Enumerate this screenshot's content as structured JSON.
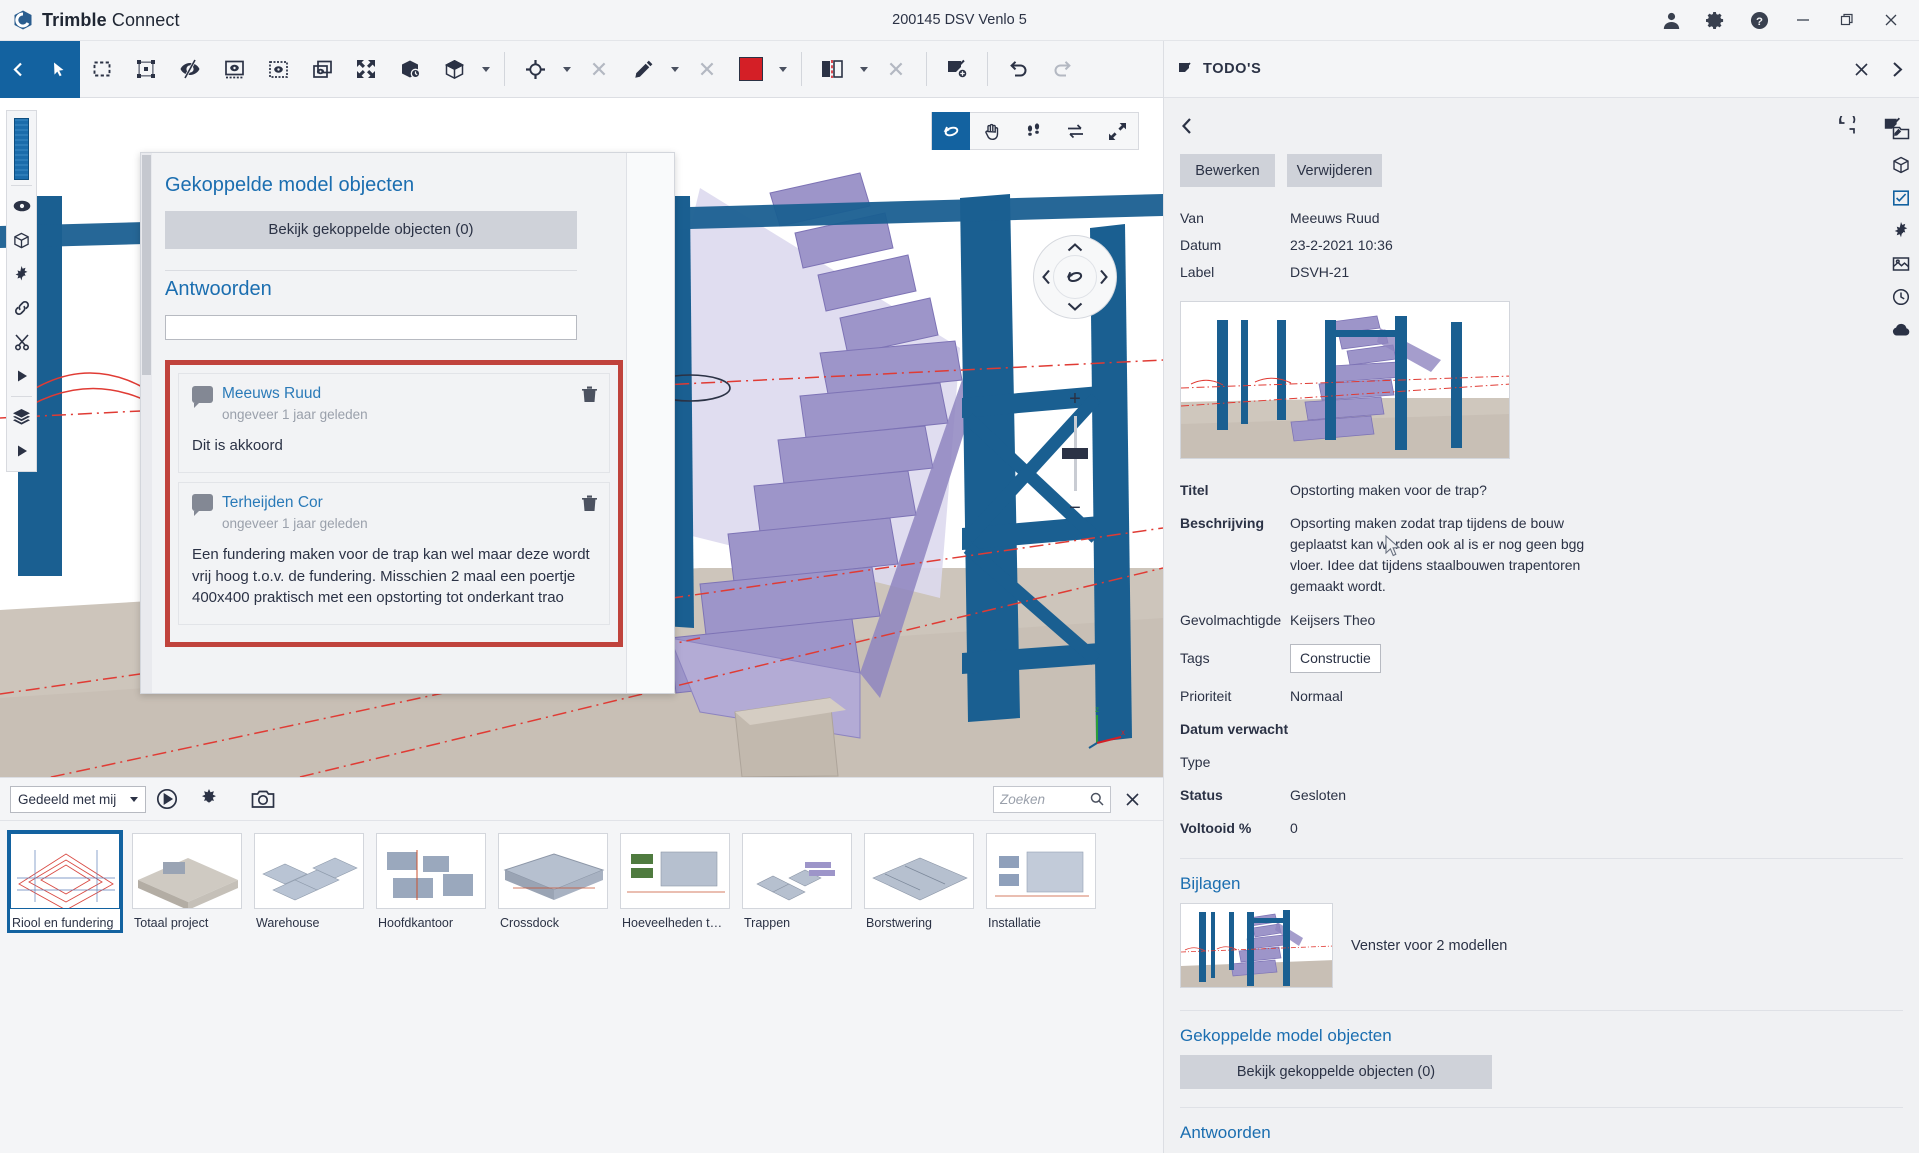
{
  "titlebar": {
    "brand_bold": "Trimble",
    "brand_light": "Connect",
    "project_title": "200145 DSV Venlo 5",
    "icons": {
      "account": "account-icon",
      "settings": "gear-icon",
      "help": "help-icon",
      "minimize": "minimize-icon",
      "restore": "restore-icon",
      "close": "close-icon"
    }
  },
  "toolbar": {
    "items": [
      {
        "name": "back-button",
        "icon": "chevron-left-icon"
      },
      {
        "name": "select-tool",
        "icon": "cursor-arrow-icon"
      },
      {
        "name": "rectangle-select-tool",
        "icon": "marquee-select-icon"
      },
      {
        "name": "transform-tool",
        "icon": "bounding-box-icon"
      },
      {
        "name": "hide-tool",
        "icon": "eye-slash-icon"
      },
      {
        "name": "isolate-tool",
        "icon": "eye-in-frame-icon"
      },
      {
        "name": "show-selection-tool",
        "icon": "eye-dotted-frame-icon"
      },
      {
        "name": "show-all-tool",
        "icon": "eye-layers-icon"
      },
      {
        "name": "fit-view-tool",
        "icon": "expand-arrows-icon"
      },
      {
        "name": "section-box-tool",
        "icon": "cube-clock-icon"
      },
      {
        "name": "cube-tool",
        "icon": "cube-icon"
      },
      {
        "name": "marker-tool",
        "icon": "target-icon"
      },
      {
        "name": "clear-marker-tool",
        "icon": "x-icon"
      },
      {
        "name": "pen-tool",
        "icon": "pencil-icon"
      },
      {
        "name": "clear-pen-tool",
        "icon": "x-icon"
      },
      {
        "name": "color-swatch",
        "icon": "color-swatch-icon"
      },
      {
        "name": "split-view-tool",
        "icon": "split-panel-icon"
      },
      {
        "name": "clear-view-tool",
        "icon": "x-icon"
      },
      {
        "name": "add-todo-tool",
        "icon": "checklist-plus-icon"
      },
      {
        "name": "undo-button",
        "icon": "undo-icon"
      },
      {
        "name": "redo-button",
        "icon": "redo-icon"
      }
    ],
    "swatch_color": "#d41f26"
  },
  "viewport": {
    "nav_tools": [
      {
        "name": "orbit-tool",
        "icon": "orbit-icon"
      },
      {
        "name": "pan-tool",
        "icon": "hand-icon"
      },
      {
        "name": "walk-tool",
        "icon": "footsteps-icon"
      },
      {
        "name": "flip-tool",
        "icon": "swap-arrows-icon"
      },
      {
        "name": "zoom-extents-tool",
        "icon": "diagonal-arrows-icon"
      }
    ],
    "left_tools": [
      {
        "name": "measure-slider",
        "icon": "gradient-slider-icon"
      },
      {
        "name": "visibility-tool",
        "icon": "eye-icon"
      },
      {
        "name": "model-tool",
        "icon": "cube-outline-icon"
      },
      {
        "name": "settings-tool",
        "icon": "gear-small-icon"
      },
      {
        "name": "link-tool",
        "icon": "link-icon"
      },
      {
        "name": "clip-tool",
        "icon": "scissors-icon"
      },
      {
        "name": "play-tool",
        "icon": "play-icon"
      },
      {
        "name": "layers-tool",
        "icon": "layers-icon"
      },
      {
        "name": "more-tool",
        "icon": "play-icon"
      }
    ],
    "wheel": {
      "up": "chevron-up-icon",
      "down": "chevron-down-icon",
      "left": "chevron-left-icon",
      "right": "chevron-right-icon",
      "center": "orbit-icon"
    },
    "zoom": {
      "plus": "+",
      "minus": "−"
    }
  },
  "modal": {
    "linked_objects_heading": "Gekoppelde model objecten",
    "view_linked_button": "Bekijk gekoppelde objecten (0)",
    "answers_heading": "Antwoorden",
    "answer_placeholder": "",
    "answer_value": "",
    "comments": [
      {
        "author": "Meeuws Ruud",
        "time": "ongeveer 1 jaar geleden",
        "text": "Dit is akkoord",
        "delete_icon": "trash-icon"
      },
      {
        "author": "Terheijden Cor",
        "time": "ongeveer 1 jaar geleden",
        "text": "Een fundering maken voor de trap kan wel maar deze wordt vrij hoog t.o.v. de fundering. Misschien 2 maal een poertje 400x400 praktisch met een opstorting tot onderkant trao",
        "delete_icon": "trash-icon"
      }
    ]
  },
  "bottombar": {
    "filter_value": "Gedeeld met mij",
    "play_icon": "play-icon",
    "settings_icon": "gear-icon",
    "camera_icon": "camera-icon",
    "search_placeholder": "Zoeken",
    "search_value": "",
    "search_icon": "search-icon",
    "close_icon": "close-icon"
  },
  "thumbnails": [
    {
      "label": "Riool en fundering",
      "selected": true
    },
    {
      "label": "Totaal project",
      "selected": false
    },
    {
      "label": "Warehouse",
      "selected": false
    },
    {
      "label": "Hoofdkantoor",
      "selected": false
    },
    {
      "label": "Crossdock",
      "selected": false
    },
    {
      "label": "Hoeveelheden teke",
      "selected": false
    },
    {
      "label": "Trappen",
      "selected": false
    },
    {
      "label": "Borstwering",
      "selected": false
    },
    {
      "label": "Installatie",
      "selected": false
    }
  ],
  "rightpanel": {
    "header_title": "TODO'S",
    "header_icon": "checklist-icon",
    "close_icon": "close-icon",
    "expand_icon": "chevron-right-icon",
    "back_icon": "chevron-left-icon",
    "refresh_icon": "refresh-icon",
    "edit_todo_icon": "checklist-edit-icon",
    "buttons": {
      "edit": "Bewerken",
      "delete": "Verwijderen"
    },
    "meta_top": [
      {
        "key": "Van",
        "value": "Meeuws Ruud"
      },
      {
        "key": "Datum",
        "value": "23-2-2021 10:36"
      },
      {
        "key": "Label",
        "value": "DSVH-21"
      }
    ],
    "details": [
      {
        "key": "Titel",
        "value": "Opstorting maken voor de trap?",
        "bold": true
      },
      {
        "key": "Beschrijving",
        "value": "Opsorting maken zodat trap tijdens de bouw geplaatst kan worden ook al is er nog geen bgg vloer. Idee dat tijdens staalbouwen trapentoren gemaakt wordt.",
        "bold": true
      },
      {
        "key": "Gevolmachtigde",
        "value": "Keijsers Theo",
        "bold": false
      },
      {
        "key": "Tags",
        "value": "Constructie",
        "bold": false,
        "is_tag": true
      },
      {
        "key": "Prioriteit",
        "value": "Normaal",
        "bold": false
      },
      {
        "key": "Datum verwacht",
        "value": "",
        "bold": true
      },
      {
        "key": "Type",
        "value": "",
        "bold": false
      },
      {
        "key": "Status",
        "value": "Gesloten",
        "bold": true
      },
      {
        "key": "Voltooid %",
        "value": "0",
        "bold": true
      }
    ],
    "attachments_heading": "Bijlagen",
    "attachment_label": "Venster voor 2 modellen",
    "linked_objects_heading": "Gekoppelde model objecten",
    "view_linked_button": "Bekijk gekoppelde objecten (0)",
    "answers_heading": "Antwoorden",
    "rail_icons": [
      {
        "name": "rail-project-icon",
        "active": false
      },
      {
        "name": "rail-model-icon",
        "active": false
      },
      {
        "name": "rail-todo-icon",
        "active": true
      },
      {
        "name": "rail-settings-icon",
        "active": false
      },
      {
        "name": "rail-views-icon",
        "active": false
      },
      {
        "name": "rail-history-icon",
        "active": false
      },
      {
        "name": "rail-cloud-icon",
        "active": false
      }
    ]
  }
}
